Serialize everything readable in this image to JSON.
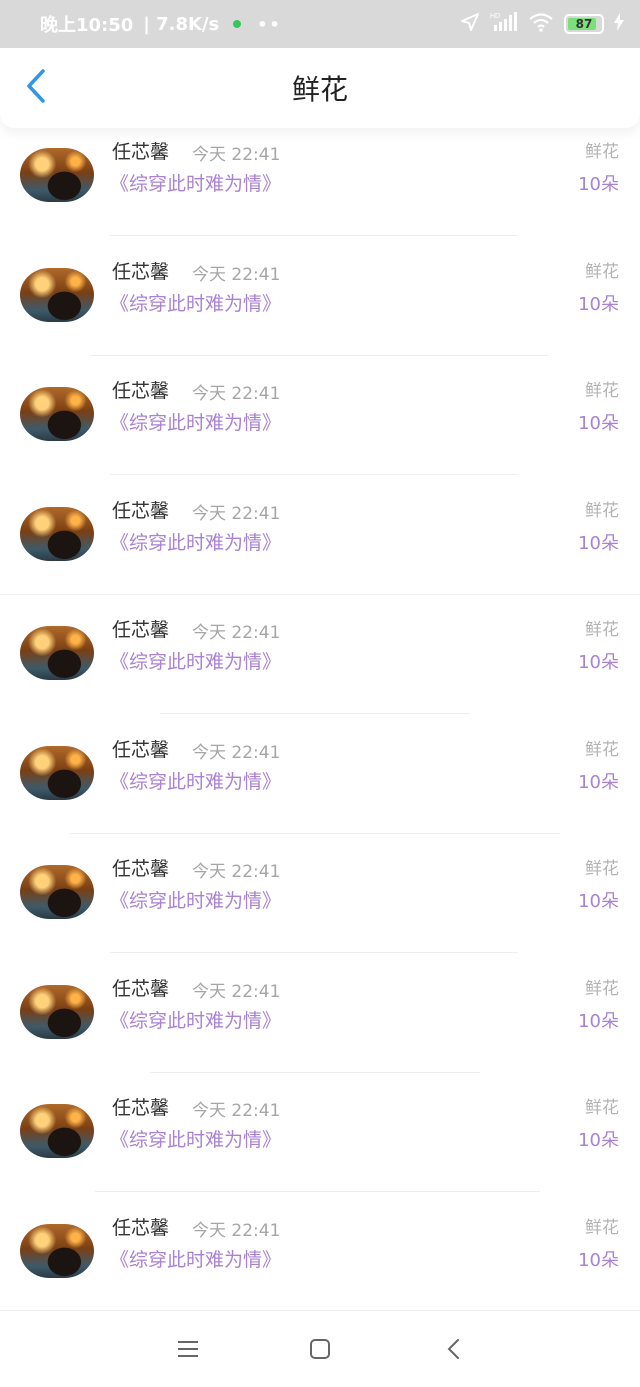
{
  "status_bar": {
    "time": "晚上10:50",
    "speed": "| 7.8K/s",
    "more": "••",
    "battery": "87",
    "network_icon": "hd-signal-icon"
  },
  "header": {
    "title": "鲜花",
    "back_icon": "chevron-left-icon"
  },
  "colors": {
    "accent": "#a982d4",
    "back_arrow": "#2f96e8",
    "status_bar_bg": "#d9d9d9"
  },
  "records": [
    {
      "name": "任芯馨",
      "time": "今天 22:41",
      "book": "《综穿此时难为情》",
      "gift": "鲜花",
      "count": "10朵"
    },
    {
      "name": "任芯馨",
      "time": "今天 22:41",
      "book": "《综穿此时难为情》",
      "gift": "鲜花",
      "count": "10朵"
    },
    {
      "name": "任芯馨",
      "time": "今天 22:41",
      "book": "《综穿此时难为情》",
      "gift": "鲜花",
      "count": "10朵"
    },
    {
      "name": "任芯馨",
      "time": "今天 22:41",
      "book": "《综穿此时难为情》",
      "gift": "鲜花",
      "count": "10朵"
    },
    {
      "name": "任芯馨",
      "time": "今天 22:41",
      "book": "《综穿此时难为情》",
      "gift": "鲜花",
      "count": "10朵"
    },
    {
      "name": "任芯馨",
      "time": "今天 22:41",
      "book": "《综穿此时难为情》",
      "gift": "鲜花",
      "count": "10朵"
    },
    {
      "name": "任芯馨",
      "time": "今天 22:41",
      "book": "《综穿此时难为情》",
      "gift": "鲜花",
      "count": "10朵"
    },
    {
      "name": "任芯馨",
      "time": "今天 22:41",
      "book": "《综穿此时难为情》",
      "gift": "鲜花",
      "count": "10朵"
    },
    {
      "name": "任芯馨",
      "time": "今天 22:41",
      "book": "《综穿此时难为情》",
      "gift": "鲜花",
      "count": "10朵"
    },
    {
      "name": "任芯馨",
      "time": "今天 22:41",
      "book": "《综穿此时难为情》",
      "gift": "鲜花",
      "count": "10朵"
    }
  ],
  "system_nav": {
    "menu_icon": "menu-icon",
    "home_icon": "home-square-icon",
    "back_icon": "back-chevron-icon"
  }
}
